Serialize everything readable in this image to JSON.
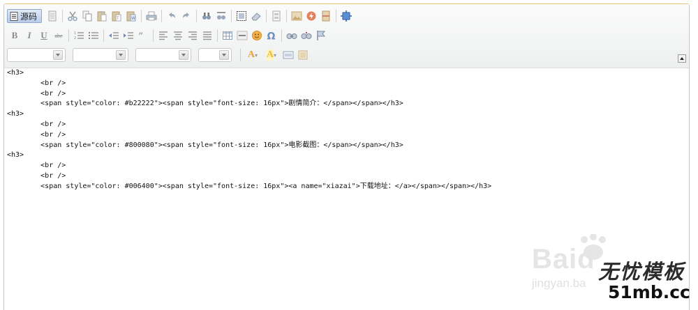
{
  "toolbar": {
    "source_label": "源码",
    "format_labels": {
      "bold": "B",
      "italic": "I",
      "underline": "U",
      "strike": "abc"
    },
    "text_color_label": "A",
    "bg_color_label": "A",
    "dropdowns": [
      {
        "name": "style-select",
        "value": ""
      },
      {
        "name": "format-select",
        "value": ""
      },
      {
        "name": "font-select",
        "value": ""
      },
      {
        "name": "size-select",
        "value": ""
      }
    ],
    "colors": {
      "accent_border": "#e6c57a",
      "source_active_bg": "#c9d8ee"
    }
  },
  "editor": {
    "source_lines": [
      "<h3>",
      "        <br />",
      "        <br />",
      "        <span style=\"color: #b22222\"><span style=\"font-size: 16px\">剧情简介：</span></span></h3>",
      "<h3>",
      "        <br />",
      "        <br />",
      "        <span style=\"color: #800080\"><span style=\"font-size: 16px\">电影截图：</span></span></h3>",
      "<h3>",
      "        <br />",
      "        <br />",
      "        <span style=\"color: #006400\"><span style=\"font-size: 16px\"><a name=\"xiazai\">下载地址：</a></span></span></h3>"
    ]
  },
  "watermark": {
    "baidu": "Baid",
    "jingyan": "jingyan.ba",
    "brand": "无忧模板",
    "domain": "51mb.cc"
  }
}
